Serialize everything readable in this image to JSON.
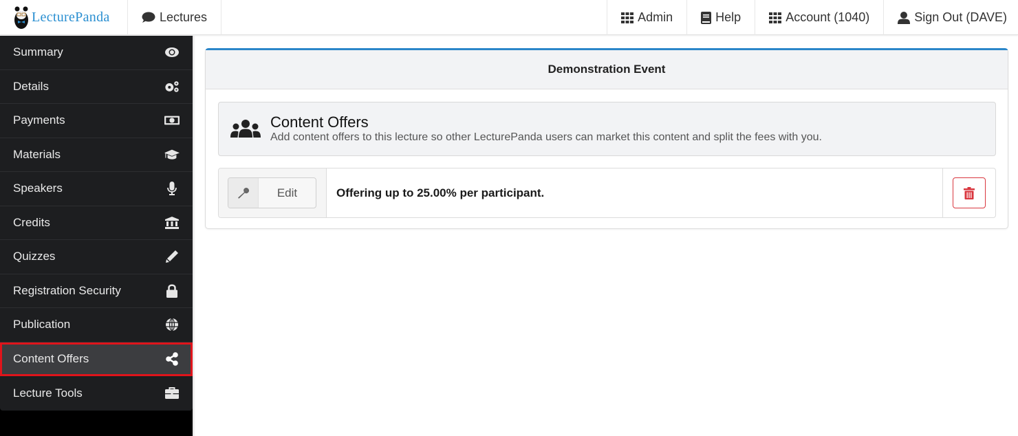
{
  "topnav": {
    "brand": {
      "first": "Lecture",
      "second": "Panda"
    },
    "left_items": [
      {
        "label": "Lectures",
        "icon": "comment-icon"
      }
    ],
    "right_items": [
      {
        "label": "Admin",
        "icon": "grid-icon"
      },
      {
        "label": "Help",
        "icon": "book-icon"
      },
      {
        "label": "Account (1040)",
        "icon": "grid-icon"
      },
      {
        "label": "Sign Out (DAVE)",
        "icon": "user-icon"
      }
    ]
  },
  "sidebar": {
    "items": [
      {
        "label": "Summary",
        "icon": "eye-icon",
        "active": false
      },
      {
        "label": "Details",
        "icon": "cogs-icon",
        "active": false
      },
      {
        "label": "Payments",
        "icon": "money-icon",
        "active": false
      },
      {
        "label": "Materials",
        "icon": "graduation-cap-icon",
        "active": false
      },
      {
        "label": "Speakers",
        "icon": "microphone-icon",
        "active": false
      },
      {
        "label": "Credits",
        "icon": "bank-icon",
        "active": false
      },
      {
        "label": "Quizzes",
        "icon": "pencil-icon",
        "active": false
      },
      {
        "label": "Registration Security",
        "icon": "lock-icon",
        "active": false
      },
      {
        "label": "Publication",
        "icon": "globe-icon",
        "active": false
      },
      {
        "label": "Content Offers",
        "icon": "share-icon",
        "active": true
      },
      {
        "label": "Lecture Tools",
        "icon": "briefcase-icon",
        "active": false
      }
    ]
  },
  "main": {
    "panel_title": "Demonstration Event",
    "section": {
      "title": "Content Offers",
      "description": "Add content offers to this lecture so other LecturePanda users can market this content and split the fees with you.",
      "icon": "users-icon"
    },
    "offers": [
      {
        "edit_label": "Edit",
        "text": "Offering up to 25.00% per participant."
      }
    ]
  },
  "colors": {
    "accent": "#2b86c9",
    "brand": "#2a8fd1",
    "sidebar_bg": "#1d1e20",
    "sidebar_active": "#3c3d40",
    "highlight": "#e0141b",
    "danger": "#d9363e"
  }
}
